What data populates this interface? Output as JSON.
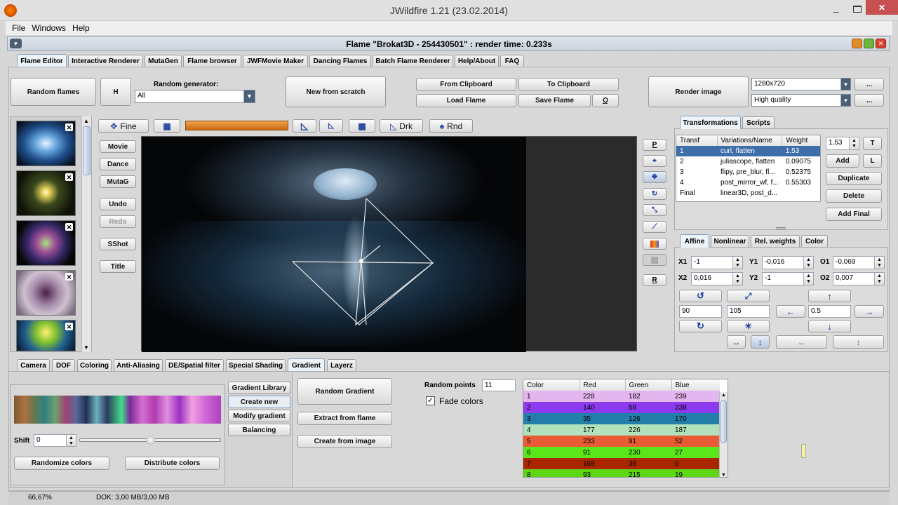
{
  "window": {
    "title": "JWildfire 1.21 (23.02.2014)"
  },
  "menu": [
    "File",
    "Windows",
    "Help"
  ],
  "internal_title": "Flame \"Brokat3D - 254430501\" : render time: 0.233s",
  "main_tabs": [
    "Flame Editor",
    "Interactive Renderer",
    "MutaGen",
    "Flame browser",
    "JWFMovie Maker",
    "Dancing Flames",
    "Batch Flame Renderer",
    "Help/About",
    "FAQ"
  ],
  "toolbar": {
    "random_flames": "Random flames",
    "h": "H",
    "random_generator_label": "Random generator:",
    "random_generator_value": "All",
    "new_from_scratch": "New from scratch",
    "from_clipboard": "From Clipboard",
    "to_clipboard": "To Clipboard",
    "load_flame": "Load Flame",
    "save_flame": "Save Flame",
    "q": "Q",
    "render_image": "Render image",
    "resolution": "1280x720",
    "quality": "High quality",
    "more": "..."
  },
  "preview_toolbar": {
    "fine": "Fine",
    "drk": "Drk",
    "rnd": "Rnd"
  },
  "left_buttons": [
    "Movie",
    "Dance",
    "MutaG",
    "Undo",
    "Redo",
    "SShot",
    "Title"
  ],
  "right_buttons": {
    "p": "P",
    "r": "R"
  },
  "transform_tabs": [
    "Transformations",
    "Scripts"
  ],
  "transform_table": {
    "headers": [
      "Transf",
      "Variations/Name",
      "Weight"
    ],
    "rows": [
      [
        "1",
        "curl, flatten",
        "1.53"
      ],
      [
        "2",
        "juliascope, flatten",
        "0.09075"
      ],
      [
        "3",
        "flipy, pre_blur, fl...",
        "0.52375"
      ],
      [
        "4",
        "post_mirror_wf, f...",
        "0.55303"
      ],
      [
        "Final",
        "linear3D, post_d...",
        ""
      ]
    ]
  },
  "transform_side": {
    "weight": "1,53",
    "t": "T",
    "add": "Add",
    "l": "L",
    "duplicate": "Duplicate",
    "delete": "Delete",
    "add_final": "Add Final"
  },
  "affine_tabs": [
    "Affine",
    "Nonlinear",
    "Rel. weights",
    "Color"
  ],
  "affine": {
    "x1_label": "X1",
    "x1": "-1",
    "y1_label": "Y1",
    "y1": "-0,016",
    "o1_label": "O1",
    "o1": "-0,069",
    "x2_label": "X2",
    "x2": "0,016",
    "y2_label": "Y2",
    "y2": "-1",
    "o2_label": "O2",
    "o2": "0,007",
    "rotate_value": "90",
    "scale_value": "105",
    "move_value": "0.5"
  },
  "bottom_tabs": [
    "Camera",
    "DOF",
    "Coloring",
    "Anti-Aliasing",
    "DE/Spatial filter",
    "Special Shading",
    "Gradient",
    "Layerz"
  ],
  "gradient": {
    "shift_label": "Shift",
    "shift": "0",
    "randomize_colors": "Randomize colors",
    "distribute_colors": "Distribute colors",
    "side_tabs": [
      "Gradient Library",
      "Create new",
      "Modify gradient",
      "Balancing"
    ],
    "random_gradient": "Random Gradient",
    "extract_from_flame": "Extract from flame",
    "create_from_image": "Create from image",
    "random_points_label": "Random points",
    "random_points": "11",
    "fade_colors": "Fade colors",
    "table_headers": [
      "Color",
      "Red",
      "Green",
      "Blue"
    ],
    "rows": [
      {
        "c": "1",
        "r": "228",
        "g": "182",
        "b": "239",
        "bg": "#e4b6ef"
      },
      {
        "c": "2",
        "r": "140",
        "g": "58",
        "b": "238",
        "bg": "#8c3aee"
      },
      {
        "c": "3",
        "r": "35",
        "g": "126",
        "b": "170",
        "bg": "#237eaa"
      },
      {
        "c": "4",
        "r": "177",
        "g": "226",
        "b": "187",
        "bg": "#b1e2bb"
      },
      {
        "c": "5",
        "r": "233",
        "g": "91",
        "b": "52",
        "bg": "#e95b34"
      },
      {
        "c": "6",
        "r": "91",
        "g": "230",
        "b": "27",
        "bg": "#5be61b"
      },
      {
        "c": "7",
        "r": "169",
        "g": "38",
        "b": "0",
        "bg": "#a92600"
      },
      {
        "c": "8",
        "r": "93",
        "g": "215",
        "b": "19",
        "bg": "#5dd713"
      }
    ]
  },
  "status": {
    "zoom": "66,67%",
    "memory": "DOK: 3,00 MB/3,00 MB"
  }
}
